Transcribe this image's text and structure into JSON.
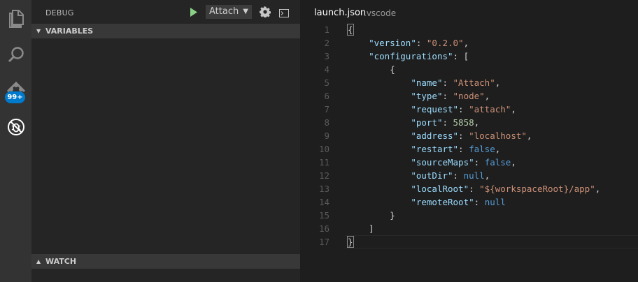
{
  "activity_bar": {
    "icons": [
      "explorer-icon",
      "search-icon",
      "git-icon",
      "debug-icon"
    ],
    "git_badge": "99+",
    "colors": {
      "badge": "#007acc"
    }
  },
  "debug_panel": {
    "title": "DEBUG",
    "configuration": "Attach",
    "variables_label": "VARIABLES",
    "watch_label": "WATCH",
    "colors": {
      "play": "#89d185"
    }
  },
  "editor": {
    "file_name": "launch.json",
    "folder": ".vscode",
    "line_numbers": [
      "1",
      "2",
      "3",
      "4",
      "5",
      "6",
      "7",
      "8",
      "9",
      "10",
      "11",
      "12",
      "13",
      "14",
      "15",
      "16",
      "17"
    ],
    "lines": [
      [
        {
          "t": "{",
          "c": "brace"
        }
      ],
      [
        {
          "t": "    "
        },
        {
          "t": "\"version\"",
          "c": "k"
        },
        {
          "t": ": "
        },
        {
          "t": "\"0.2.0\"",
          "c": "s"
        },
        {
          "t": ","
        }
      ],
      [
        {
          "t": "    "
        },
        {
          "t": "\"configurations\"",
          "c": "k"
        },
        {
          "t": ": ["
        }
      ],
      [
        {
          "t": "        {"
        }
      ],
      [
        {
          "t": "            "
        },
        {
          "t": "\"name\"",
          "c": "k"
        },
        {
          "t": ": "
        },
        {
          "t": "\"Attach\"",
          "c": "s"
        },
        {
          "t": ","
        }
      ],
      [
        {
          "t": "            "
        },
        {
          "t": "\"type\"",
          "c": "k"
        },
        {
          "t": ": "
        },
        {
          "t": "\"node\"",
          "c": "s"
        },
        {
          "t": ","
        }
      ],
      [
        {
          "t": "            "
        },
        {
          "t": "\"request\"",
          "c": "k"
        },
        {
          "t": ": "
        },
        {
          "t": "\"attach\"",
          "c": "s"
        },
        {
          "t": ","
        }
      ],
      [
        {
          "t": "            "
        },
        {
          "t": "\"port\"",
          "c": "k"
        },
        {
          "t": ": "
        },
        {
          "t": "5858",
          "c": "n"
        },
        {
          "t": ","
        }
      ],
      [
        {
          "t": "            "
        },
        {
          "t": "\"address\"",
          "c": "k"
        },
        {
          "t": ": "
        },
        {
          "t": "\"localhost\"",
          "c": "s"
        },
        {
          "t": ","
        }
      ],
      [
        {
          "t": "            "
        },
        {
          "t": "\"restart\"",
          "c": "k"
        },
        {
          "t": ": "
        },
        {
          "t": "false",
          "c": "b"
        },
        {
          "t": ","
        }
      ],
      [
        {
          "t": "            "
        },
        {
          "t": "\"sourceMaps\"",
          "c": "k"
        },
        {
          "t": ": "
        },
        {
          "t": "false",
          "c": "b"
        },
        {
          "t": ","
        }
      ],
      [
        {
          "t": "            "
        },
        {
          "t": "\"outDir\"",
          "c": "k"
        },
        {
          "t": ": "
        },
        {
          "t": "null",
          "c": "b"
        },
        {
          "t": ","
        }
      ],
      [
        {
          "t": "            "
        },
        {
          "t": "\"localRoot\"",
          "c": "k"
        },
        {
          "t": ": "
        },
        {
          "t": "\"${workspaceRoot}/app\"",
          "c": "s"
        },
        {
          "t": ","
        }
      ],
      [
        {
          "t": "            "
        },
        {
          "t": "\"remoteRoot\"",
          "c": "k"
        },
        {
          "t": ": "
        },
        {
          "t": "null",
          "c": "b"
        }
      ],
      [
        {
          "t": "        }"
        }
      ],
      [
        {
          "t": "    ]"
        }
      ],
      [
        {
          "t": "}",
          "c": "brace"
        }
      ]
    ],
    "current_line": 17,
    "colors": {
      "key": "#9cdcfe",
      "string": "#ce9178",
      "number": "#b5cea8",
      "keyword": "#569cd6"
    }
  }
}
